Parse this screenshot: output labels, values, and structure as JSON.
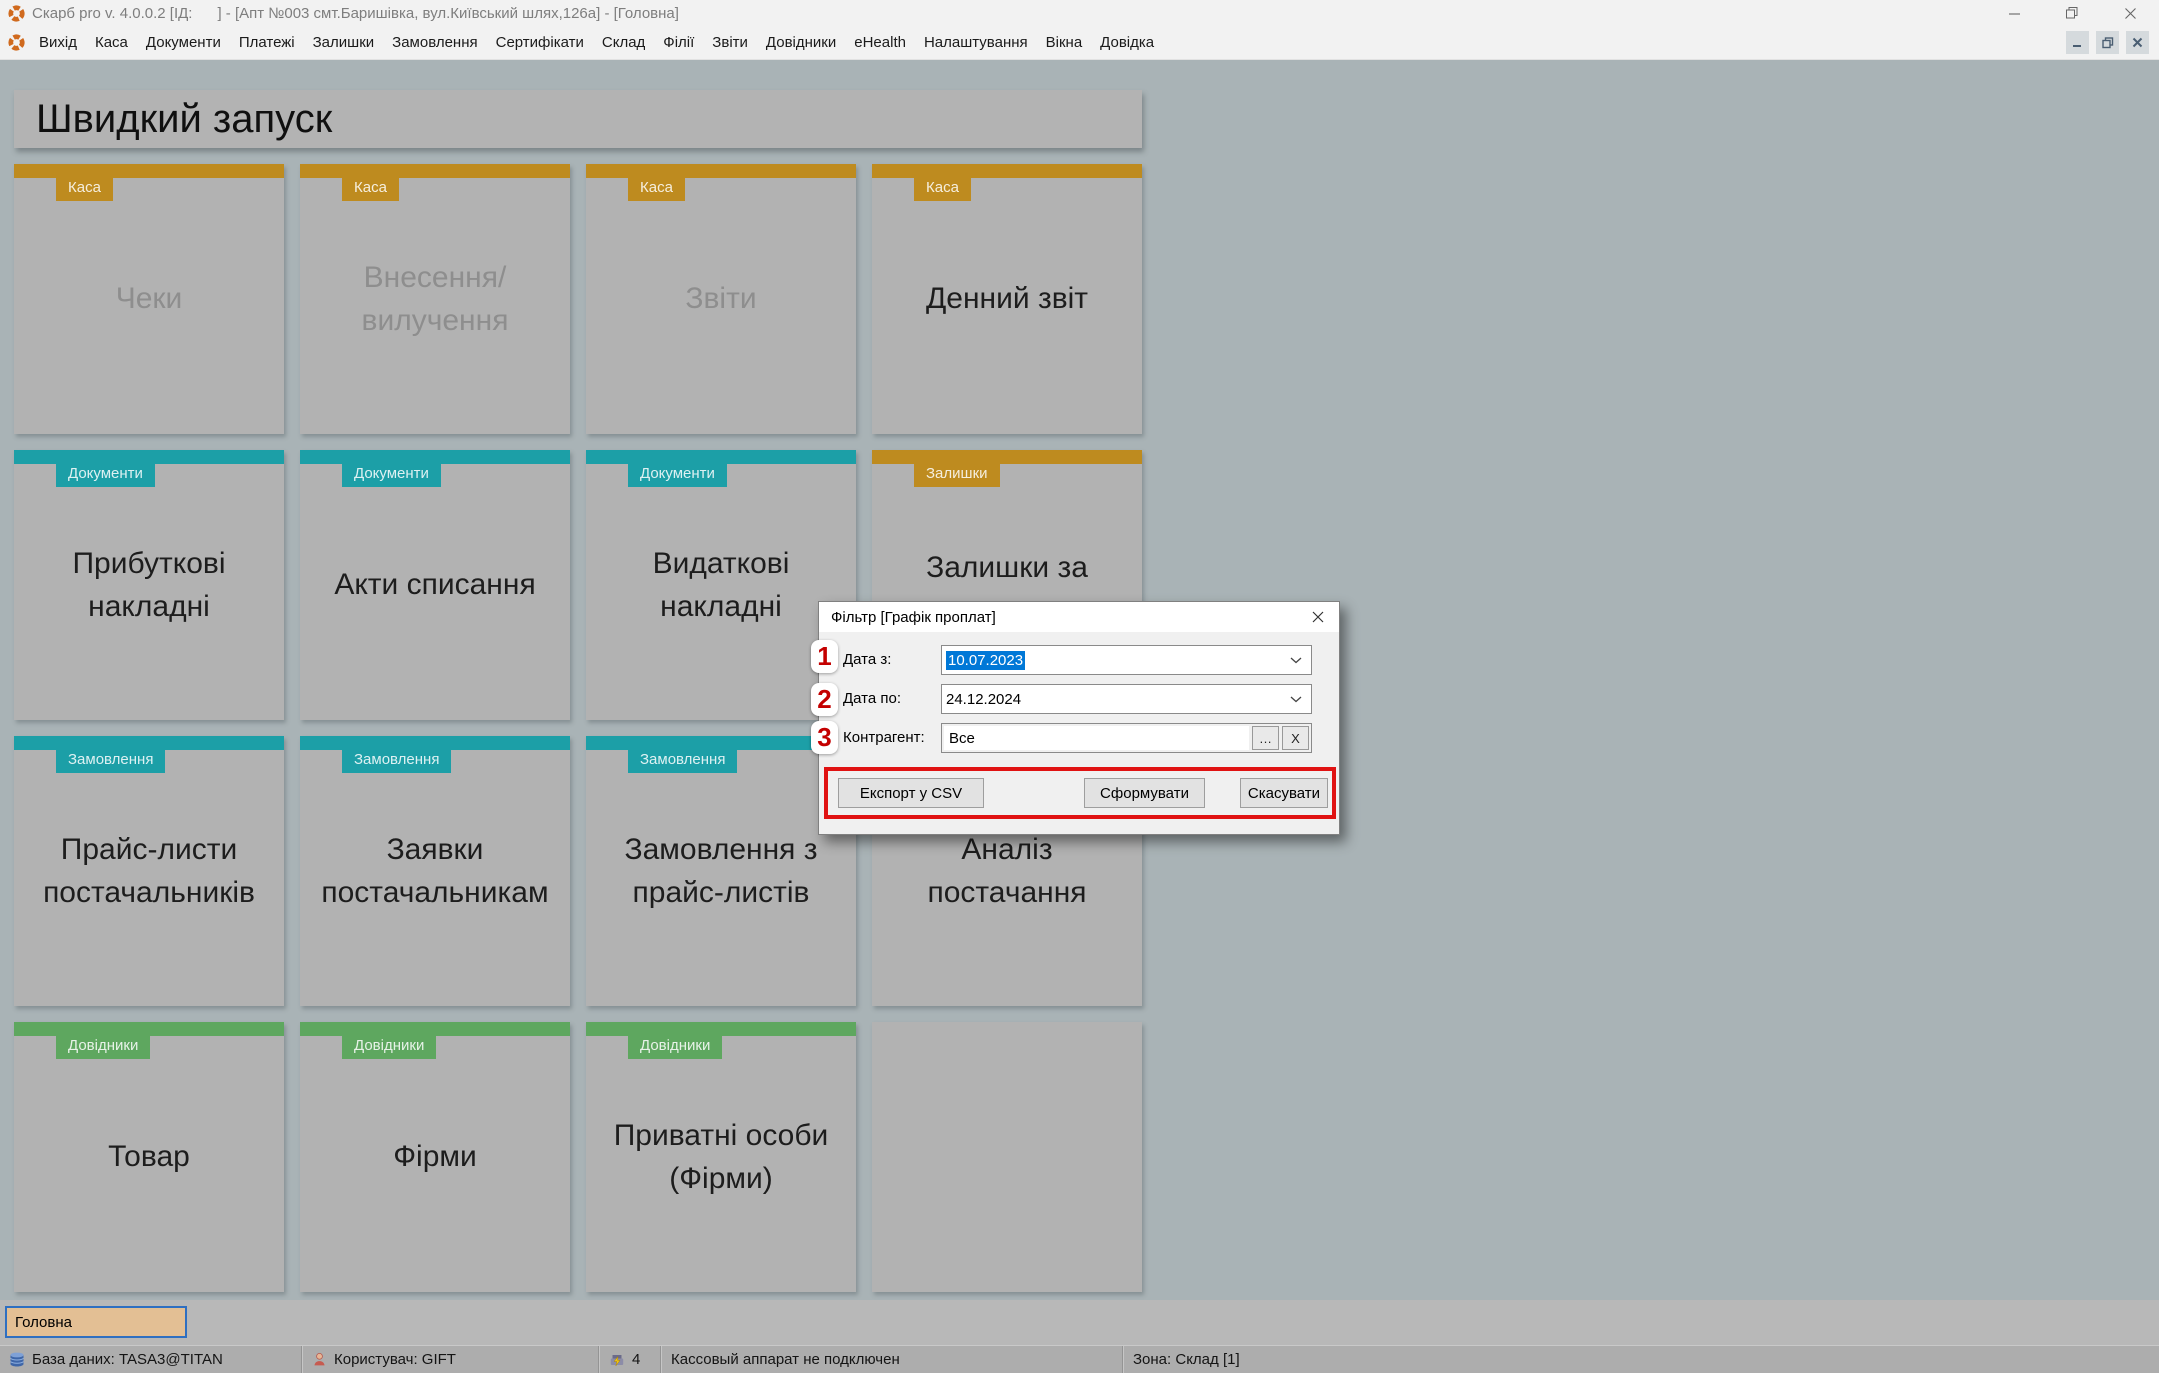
{
  "titlebar": {
    "title": "Скарб pro v. 4.0.0.2 [ІД:      ] - [Апт №003 смт.Баришівка, вул.Київський шлях,126а] - [Головна]"
  },
  "menu": {
    "items": [
      "Вихід",
      "Каса",
      "Документи",
      "Платежі",
      "Залишки",
      "Замовлення",
      "Сертифікати",
      "Склад",
      "Філії",
      "Звіти",
      "Довідники",
      "eHealth",
      "Налаштування",
      "Вікна",
      "Довідка"
    ]
  },
  "quick_launch": {
    "title": "Швидкий запуск",
    "tiles": [
      {
        "category": "Каса",
        "label": "Чеки"
      },
      {
        "category": "Каса",
        "label": "Внесення/вилучення"
      },
      {
        "category": "Каса",
        "label": "Звіти"
      },
      {
        "category": "Каса",
        "label": "Денний звіт"
      },
      {
        "category": "Документи",
        "label": "Прибуткові накладні"
      },
      {
        "category": "Документи",
        "label": "Акти списання"
      },
      {
        "category": "Документи",
        "label": "Видаткові накладні"
      },
      {
        "category": "Залишки",
        "label": "Залишки за"
      },
      {
        "category": "Замовлення",
        "label": "Прайс-листи постачальників"
      },
      {
        "category": "Замовлення",
        "label": "Заявки постачальникам"
      },
      {
        "category": "Замовлення",
        "label": "Замовлення з прайс-листів"
      },
      {
        "category": "Замовлення",
        "label": "Аналіз постачання"
      },
      {
        "category": "Довідники",
        "label": "Товар"
      },
      {
        "category": "Довідники",
        "label": "Фірми"
      },
      {
        "category": "Довідники",
        "label": "Приватні особи (Фірми)"
      },
      {
        "category": "",
        "label": ""
      }
    ]
  },
  "dialog": {
    "title": "Фільтр [Графік проплат]",
    "rows": [
      {
        "marker": "1",
        "label": "Дата з:",
        "value": "10.07.2023"
      },
      {
        "marker": "2",
        "label": "Дата по:",
        "value": "24.12.2024"
      },
      {
        "marker": "3",
        "label": "Контрагент:",
        "value": "Все",
        "browse": "…",
        "clear": "X"
      }
    ],
    "buttons": {
      "export": "Експорт у CSV",
      "generate": "Сформувати",
      "cancel": "Скасувати"
    }
  },
  "tabs": {
    "home": "Головна"
  },
  "status_bar": {
    "database": "База даних: TASA3@TITAN",
    "user": "Користувач: GIFT",
    "count": "4",
    "cash_register": "Кассовый аппарат не подключен",
    "zone": "Зона: Склад [1]"
  },
  "colors": {
    "category_kasa": "#BE8B1F",
    "category_dokumenty": "#1C9FA7",
    "category_zalyshky": "#BE8B1F",
    "category_zamovlennia": "#1C9FA7",
    "category_dovidnyky": "#5EA75F",
    "selection": "#0078D7",
    "annotation_number": "#C40000",
    "highlight_box": "#E01212",
    "tab_fill": "#E3BF94",
    "tab_border": "#2F6FC1"
  },
  "icons": {
    "app": "orange-segmented-ring",
    "database": "blue-cylinder",
    "user": "person",
    "cash_device": "device-with-lightning",
    "dropdown": "chevron-down",
    "close": "x-cross"
  }
}
